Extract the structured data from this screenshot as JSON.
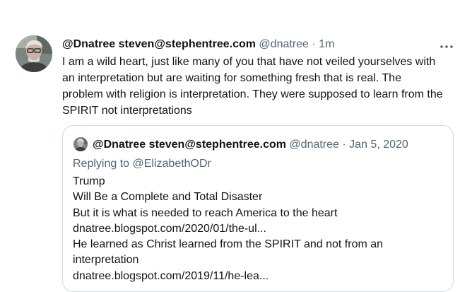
{
  "tweet": {
    "display_name": "@Dnatree steven@stephentree.com",
    "handle": "@dnatree",
    "separator": "·",
    "time": "1m",
    "text": "I am a wild heart, just like many of you that have not veiled yourselves with an interpretation but are waiting for something fresh that is real. The problem with religion is interpretation. They were supposed to learn from the SPIRIT not interpretations",
    "more_icon": "more-horizontal-icon",
    "quoted": {
      "display_name": "@Dnatree steven@stephentree.com",
      "handle": "@dnatree",
      "separator": "·",
      "date": "Jan 5, 2020",
      "replying_to": "Replying to @ElizabethODr",
      "lines": [
        "Trump",
        "Will Be a Complete and Total Disaster",
        "But it is what is needed to reach America to the heart",
        "dnatree.blogspot.com/2020/01/the-ul...",
        "He learned as Christ learned from the SPIRIT and not from an",
        "interpretation",
        "dnatree.blogspot.com/2019/11/he-lea..."
      ]
    }
  },
  "colors": {
    "text": "#0f1419",
    "muted": "#536471",
    "border": "#cfd9de",
    "background": "#ffffff"
  }
}
